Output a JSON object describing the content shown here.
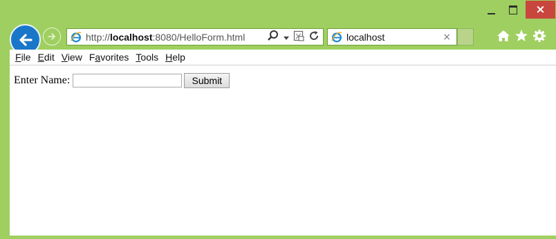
{
  "window": {
    "minimize_icon": "minimize-icon",
    "maximize_icon": "maximize-icon",
    "close_glyph": "×"
  },
  "nav": {
    "back_icon": "back-arrow-icon",
    "forward_icon": "forward-arrow-icon",
    "url_prefix": "http://",
    "url_host": "localhost",
    "url_rest": ":8080/HelloForm.html",
    "tab_title": "localhost",
    "tab_close_glyph": "×"
  },
  "menu": {
    "items": [
      "File",
      "Edit",
      "View",
      "Favorites",
      "Tools",
      "Help"
    ],
    "accelerators": [
      "F",
      "E",
      "V",
      "a",
      "T",
      "H"
    ]
  },
  "form": {
    "label": "Enter Name:",
    "input_value": "",
    "submit_label": "Submit"
  },
  "colors": {
    "frame": "#9fcf60",
    "back_button": "#1a76c8",
    "close_button": "#c8463d"
  }
}
